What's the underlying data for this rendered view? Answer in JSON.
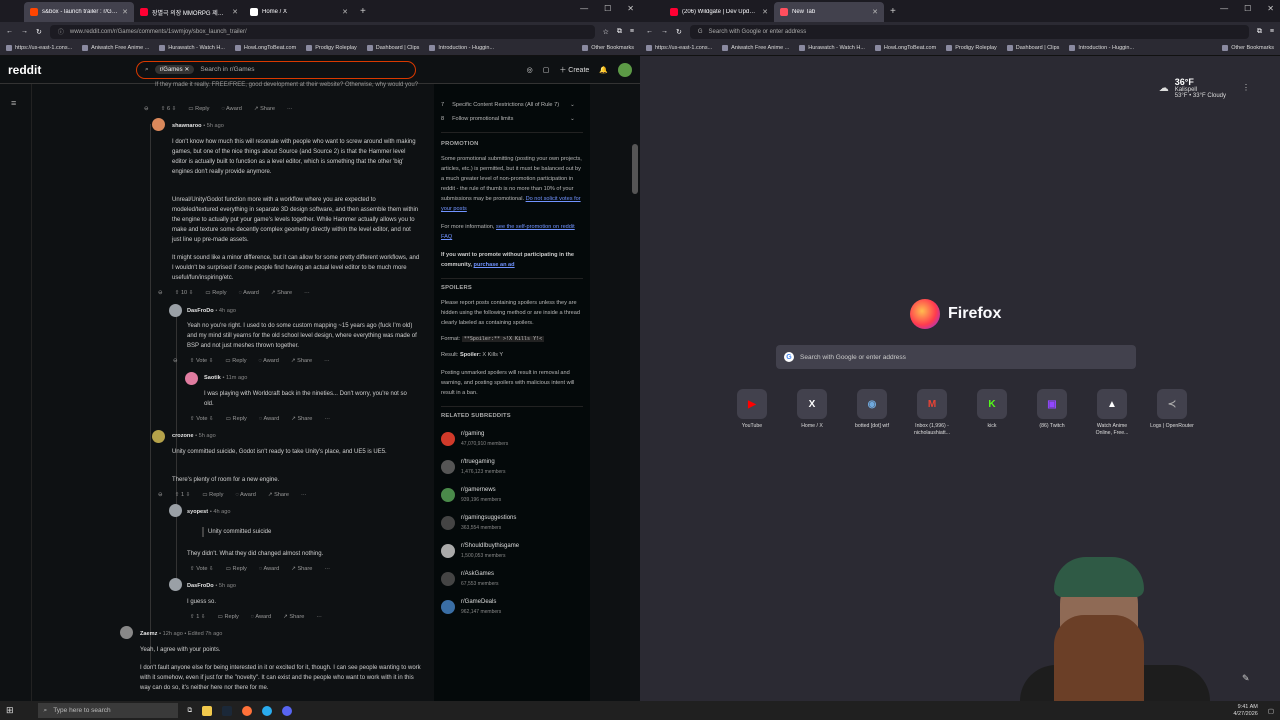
{
  "left_window": {
    "tabs": [
      {
        "title": "s&box - launch trailer : r/Games",
        "fav": "#ff4500",
        "active": true
      },
      {
        "title": "장별극 의장 MMORPG 제작은...",
        "fav": "#ff0033",
        "active": false
      },
      {
        "title": "Home / X",
        "fav": "#ffffff",
        "active": false
      }
    ],
    "url": "www.reddit.com/r/Games/comments/1swmjoy/sbox_launch_trailer/",
    "bookmarks": [
      "https://us-east-1.cons...",
      "Aniwatch Free Anime ...",
      "Hurawatch - Watch H...",
      "HowLongToBeat.com",
      "Prodigy Roleplay",
      "Dashboard | Clips",
      "Introduction - Huggin..."
    ],
    "other_bookmarks": "Other Bookmarks"
  },
  "right_window": {
    "tabs": [
      {
        "title": "(206) Wildgate | Dev Update w",
        "fav": "#ff0033",
        "active": false
      },
      {
        "title": "New Tab",
        "fav": "#ff4f5e",
        "active": true
      }
    ],
    "url_placeholder": "Search with Google or enter address",
    "bookmarks": [
      "https://us-east-1.cons...",
      "Aniwatch Free Anime ...",
      "Hurawatch - Watch H...",
      "HowLongToBeat.com",
      "Prodigy Roleplay",
      "Dashboard | Clips",
      "Introduction - Huggin..."
    ],
    "other_bookmarks": "Other Bookmarks",
    "weather": {
      "temp": "36°F",
      "place": "Kalispell",
      "detail": "53°F • 33°F  Cloudy"
    },
    "brand": "Firefox",
    "search_placeholder": "Search with Google or enter address",
    "shortcuts": [
      {
        "label": "YouTube",
        "glyph": "▶",
        "color": "#ff0000"
      },
      {
        "label": "Home / X",
        "glyph": "X",
        "color": "#ffffff"
      },
      {
        "label": "botted [dot] wtf",
        "glyph": "◉",
        "color": "#6fa8dc"
      },
      {
        "label": "Inbox (1,996) - nicholaushiatt...",
        "glyph": "M",
        "color": "#ea4335"
      },
      {
        "label": "kick",
        "glyph": "K",
        "color": "#53fc18"
      },
      {
        "label": "(86) Twitch",
        "glyph": "▣",
        "color": "#9146ff"
      },
      {
        "label": "Watch Anime Online, Free...",
        "glyph": "▲",
        "color": "#ffffff"
      },
      {
        "label": "Logs | OpenRouter",
        "glyph": "≺",
        "color": "#aaaaaa"
      }
    ]
  },
  "reddit": {
    "logo": "reddit",
    "search_chip": "r/Games",
    "search_placeholder": "Search in r/Games",
    "create": "Create",
    "comments": [
      {
        "id": "c0",
        "text": "If they made it really. FREE/FREE, good development at their website? Otherwise, why would you?",
        "votes": "6"
      },
      {
        "id": "c1",
        "user": "shawnaroo",
        "time": "5h ago",
        "paras": [
          "I don't know how much this will resonate with people who want to screw around with making games, but one of the nice things about Source (and Source 2) is that the Hammer level editor is actually built to function as a level editor, which is something that the other 'big' engines don't really provide anymore.",
          "Unreal/Unity/Godot function more with a workflow where you are expected to modeled/textured everything in separate 3D design software, and then assemble them within the engine to actually put your game's levels together. While Hammer actually allows you to make and texture some decently complex geometry directly within the level editor, and not just line up pre-made assets.",
          "It might sound like a minor difference, but it can allow for some pretty different workflows, and I wouldn't be surprised if some people find having an actual level editor to be much more useful/fun/inspiring/etc."
        ],
        "votes": "10"
      },
      {
        "id": "c2",
        "user": "DasFroDo",
        "time": "4h ago",
        "paras": [
          "Yeah no you're right. I used to do some custom mapping ~15 years ago (fuck I'm old) and my mind still yearns for the old school level design, where everything was made of BSP and not just meshes thrown together."
        ],
        "votes": "Vote"
      },
      {
        "id": "c3",
        "user": "Saotik",
        "time": "11m ago",
        "paras": [
          "I was playing with Worldcraft back in the nineties... Don't worry, you're not so old."
        ],
        "votes": "Vote"
      },
      {
        "id": "c4",
        "user": "crozone",
        "time": "5h ago",
        "paras": [
          "Unity committed suicide, Godot isn't ready to take Unity's place, and UE5 is UE5.",
          "There's plenty of room for a new engine."
        ],
        "votes": "1"
      },
      {
        "id": "c5",
        "user": "syopest",
        "time": "4h ago",
        "paras": [
          "Unity committed suicide",
          "They didn't. What they did changed almost nothing."
        ],
        "votes": "Vote"
      },
      {
        "id": "c6",
        "user": "DasFroDo",
        "time": "5h ago",
        "paras": [
          "I guess so."
        ],
        "votes": "1"
      },
      {
        "id": "c7",
        "user": "Zaemz",
        "time": "12h ago • Edited 7h ago",
        "paras": [
          "Yeah, I agree with your points.",
          "I don't fault anyone else for being interested in it or excited for it, though. I can see people wanting to work with it somehow, even if just for the \"novelty\". It can exist and the people who want to work with it in this way can do so, it's neither here nor there for me."
        ],
        "votes": ""
      }
    ],
    "actions": {
      "reply": "Reply",
      "award": "Award",
      "share": "Share"
    },
    "sidebar": {
      "rules": [
        {
          "n": "7",
          "t": "Specific Content Restrictions (All of Rule 7)"
        },
        {
          "n": "8",
          "t": "Follow promotional limits"
        }
      ],
      "promotion_h": "PROMOTION",
      "promotion_p": "Some promotional submitting (posting your own projects, articles, etc.) is permitted, but it must be balanced out by a much greater level of non-promotion participation in reddit - the rule of thumb is no more than 10% of your submissions may be promotional.",
      "promotion_link": "Do not solicit votes for your posts",
      "promotion_more": "For more information,",
      "promotion_more_link": "see the self-promotion on reddit FAQ",
      "promotion_bold": "If you want to promote without participating in the community,",
      "promotion_bold_link": "purchase an ad",
      "spoilers_h": "SPOILERS",
      "spoilers_p": "Please report posts containing spoilers unless they are hidden using the following method or are inside a thread clearly labeled as containing spoilers.",
      "format_label": "Format:",
      "format_code": "**Spoiler:** >!X Kills Y!<",
      "result_label": "Result:",
      "result_text": "Spoiler:",
      "result_hidden": "X Kills Y",
      "spoilers_p2": "Posting unmarked spoilers will result in removal and warning, and posting spoilers with malicious intent will result in a ban.",
      "related_h": "RELATED SUBREDDITS",
      "related": [
        {
          "name": "r/gaming",
          "members": "47,070,910 members"
        },
        {
          "name": "r/truegaming",
          "members": "1,476,123 members"
        },
        {
          "name": "r/gamernews",
          "members": "939,196 members"
        },
        {
          "name": "r/gamingsuggestions",
          "members": "363,554 members"
        },
        {
          "name": "r/ShouldIbuythisgame",
          "members": "1,500,053 members"
        },
        {
          "name": "r/AskGames",
          "members": "67,553 members"
        },
        {
          "name": "r/GameDeals",
          "members": "962,147 members"
        }
      ]
    }
  },
  "taskbar": {
    "search": "Type here to search",
    "time": "9:41 AM",
    "date": "4/27/2026"
  }
}
